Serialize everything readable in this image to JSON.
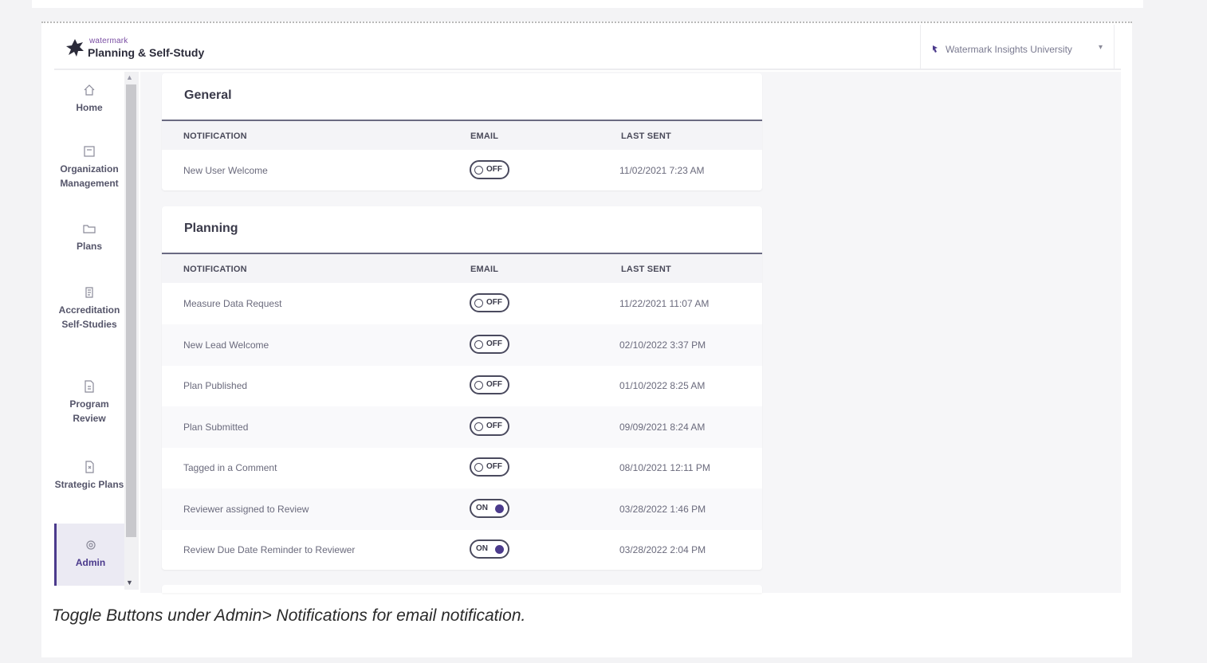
{
  "header": {
    "brand_small": "watermark",
    "brand_title": "Planning & Self-Study",
    "institution": "Watermark Insights University"
  },
  "sidebar": {
    "items": [
      {
        "label": "Home",
        "icon": "home-icon"
      },
      {
        "label": "Organization Management",
        "icon": "organization-icon"
      },
      {
        "label": "Plans",
        "icon": "folder-icon"
      },
      {
        "label": "Accreditation Self-Studies",
        "icon": "accreditation-icon"
      },
      {
        "label": "Program Review",
        "icon": "document-icon"
      },
      {
        "label": "Strategic Plans",
        "icon": "strategic-plan-icon"
      },
      {
        "label": "Admin",
        "icon": "gear-icon",
        "active": true
      }
    ]
  },
  "columns": {
    "notification": "NOTIFICATION",
    "email": "EMAIL",
    "last_sent": "LAST SENT"
  },
  "sections": [
    {
      "title": "General",
      "rows": [
        {
          "name": "New User Welcome",
          "email": "OFF",
          "last_sent": "11/02/2021 7:23 AM"
        }
      ]
    },
    {
      "title": "Planning",
      "rows": [
        {
          "name": "Measure Data Request",
          "email": "OFF",
          "last_sent": "11/22/2021 11:07 AM"
        },
        {
          "name": "New Lead Welcome",
          "email": "OFF",
          "last_sent": "02/10/2022 3:37 PM"
        },
        {
          "name": "Plan Published",
          "email": "OFF",
          "last_sent": "01/10/2022 8:25 AM"
        },
        {
          "name": "Plan Submitted",
          "email": "OFF",
          "last_sent": "09/09/2021 8:24 AM"
        },
        {
          "name": "Tagged in a Comment",
          "email": "OFF",
          "last_sent": "08/10/2021 12:11 PM"
        },
        {
          "name": "Reviewer assigned to Review",
          "email": "ON",
          "last_sent": "03/28/2022 1:46 PM"
        },
        {
          "name": "Review Due Date Reminder to Reviewer",
          "email": "ON",
          "last_sent": "03/28/2022 2:04 PM"
        }
      ]
    }
  ],
  "caption": "Toggle Buttons under Admin> Notifications for email notification.",
  "colors": {
    "accent": "#4b3a8c",
    "brand": "#7a4ea3"
  }
}
